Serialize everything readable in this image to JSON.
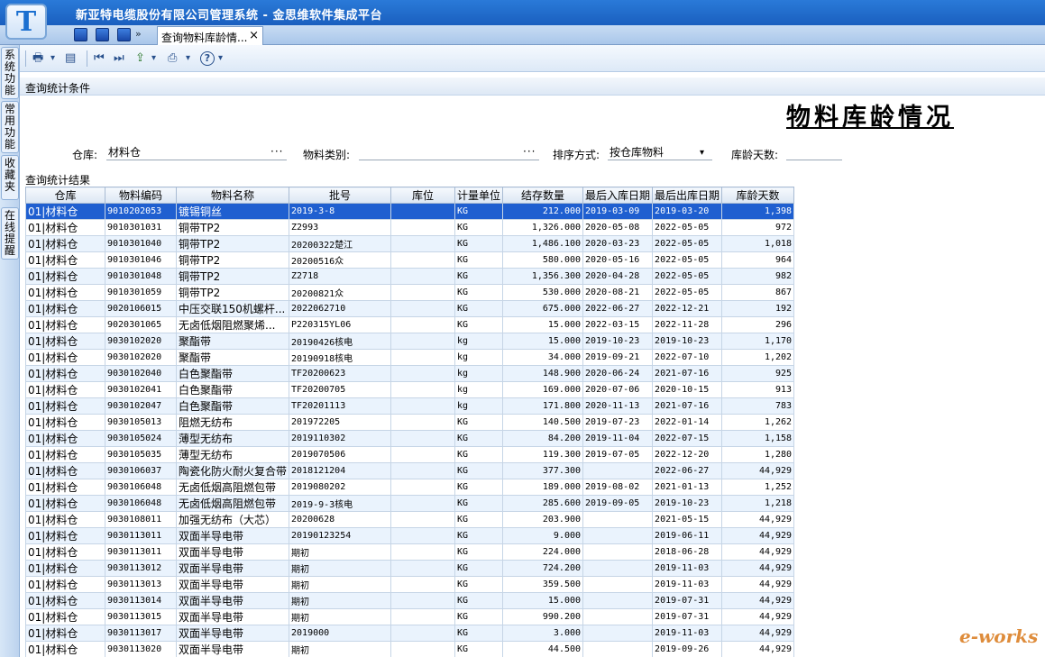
{
  "window": {
    "title": "新亚特电缆股份有限公司管理系统 - 金思维软件集成平台",
    "logo_letter": "T"
  },
  "tabs": {
    "active_label": "查询物料库龄情...",
    "close": "×",
    "quick_more": "»"
  },
  "left_nav": [
    "系统功能",
    "常用功能",
    "收藏夹",
    "在线提醒"
  ],
  "toolbar": {
    "print": "🖶",
    "dropdown": "▾",
    "design": "▤",
    "first": "⏮",
    "last": "⏭",
    "export": "⇪",
    "printer": "⎙",
    "help": "?"
  },
  "sections": {
    "criteria": "查询统计条件",
    "results": "查询统计结果"
  },
  "report_title": "物料库龄情况",
  "filters": {
    "warehouse_label": "仓库:",
    "warehouse_value": "材料仓",
    "warehouse_dots": "···",
    "category_label": "物料类别:",
    "category_value": "",
    "category_dots": "···",
    "sort_label": "排序方式:",
    "sort_value": "按仓库物料",
    "sort_caret": "▾",
    "days_label": "库龄天数:",
    "days_value": ""
  },
  "table": {
    "columns": [
      "仓库",
      "物料编码",
      "物料名称",
      "批号",
      "库位",
      "计量单位",
      "结存数量",
      "最后入库日期",
      "最后出库日期",
      "库龄天数"
    ],
    "rows": [
      [
        "01|材料仓",
        "9010202053",
        "镀锡铜丝",
        "2019-3-8",
        "",
        "KG",
        "212.000",
        "2019-03-09",
        "2019-03-20",
        "1,398"
      ],
      [
        "01|材料仓",
        "9010301031",
        "铜带TP2",
        "Z2993",
        "",
        "KG",
        "1,326.000",
        "2020-05-08",
        "2022-05-05",
        "972"
      ],
      [
        "01|材料仓",
        "9010301040",
        "铜带TP2",
        "20200322楚江",
        "",
        "KG",
        "1,486.100",
        "2020-03-23",
        "2022-05-05",
        "1,018"
      ],
      [
        "01|材料仓",
        "9010301046",
        "铜带TP2",
        "20200516众",
        "",
        "KG",
        "580.000",
        "2020-05-16",
        "2022-05-05",
        "964"
      ],
      [
        "01|材料仓",
        "9010301048",
        "铜带TP2",
        "Z2718",
        "",
        "KG",
        "1,356.300",
        "2020-04-28",
        "2022-05-05",
        "982"
      ],
      [
        "01|材料仓",
        "9010301059",
        "铜带TP2",
        "20200821众",
        "",
        "KG",
        "530.000",
        "2020-08-21",
        "2022-05-05",
        "867"
      ],
      [
        "01|材料仓",
        "9020106015",
        "中压交联150机螺杆...",
        "2022062710",
        "",
        "KG",
        "675.000",
        "2022-06-27",
        "2022-12-21",
        "192"
      ],
      [
        "01|材料仓",
        "9020301065",
        "无卤低烟阻燃聚烯...",
        "P220315YL06",
        "",
        "KG",
        "15.000",
        "2022-03-15",
        "2022-11-28",
        "296"
      ],
      [
        "01|材料仓",
        "9030102020",
        "聚酯带",
        "20190426核电",
        "",
        "kg",
        "15.000",
        "2019-10-23",
        "2019-10-23",
        "1,170"
      ],
      [
        "01|材料仓",
        "9030102020",
        "聚酯带",
        "20190918核电",
        "",
        "kg",
        "34.000",
        "2019-09-21",
        "2022-07-10",
        "1,202"
      ],
      [
        "01|材料仓",
        "9030102040",
        "白色聚酯带",
        "TF20200623",
        "",
        "kg",
        "148.900",
        "2020-06-24",
        "2021-07-16",
        "925"
      ],
      [
        "01|材料仓",
        "9030102041",
        "白色聚酯带",
        "TF20200705",
        "",
        "kg",
        "169.000",
        "2020-07-06",
        "2020-10-15",
        "913"
      ],
      [
        "01|材料仓",
        "9030102047",
        "白色聚酯带",
        "TF20201113",
        "",
        "kg",
        "171.800",
        "2020-11-13",
        "2021-07-16",
        "783"
      ],
      [
        "01|材料仓",
        "9030105013",
        "阻燃无纺布",
        "201972205",
        "",
        "KG",
        "140.500",
        "2019-07-23",
        "2022-01-14",
        "1,262"
      ],
      [
        "01|材料仓",
        "9030105024",
        "薄型无纺布",
        "2019110302",
        "",
        "KG",
        "84.200",
        "2019-11-04",
        "2022-07-15",
        "1,158"
      ],
      [
        "01|材料仓",
        "9030105035",
        "薄型无纺布",
        "2019070506",
        "",
        "KG",
        "119.300",
        "2019-07-05",
        "2022-12-20",
        "1,280"
      ],
      [
        "01|材料仓",
        "9030106037",
        "陶瓷化防火耐火复合带",
        "2018121204",
        "",
        "KG",
        "377.300",
        "",
        "2022-06-27",
        "44,929"
      ],
      [
        "01|材料仓",
        "9030106048",
        "无卤低烟高阻燃包带",
        "2019080202",
        "",
        "KG",
        "189.000",
        "2019-08-02",
        "2021-01-13",
        "1,252"
      ],
      [
        "01|材料仓",
        "9030106048",
        "无卤低烟高阻燃包带",
        "2019-9-3核电",
        "",
        "KG",
        "285.600",
        "2019-09-05",
        "2019-10-23",
        "1,218"
      ],
      [
        "01|材料仓",
        "9030108011",
        "加强无纺布（大芯）",
        "20200628",
        "",
        "KG",
        "203.900",
        "",
        "2021-05-15",
        "44,929"
      ],
      [
        "01|材料仓",
        "9030113011",
        "双面半导电带",
        "20190123254",
        "",
        "KG",
        "9.000",
        "",
        "2019-06-11",
        "44,929"
      ],
      [
        "01|材料仓",
        "9030113011",
        "双面半导电带",
        "期初",
        "",
        "KG",
        "224.000",
        "",
        "2018-06-28",
        "44,929"
      ],
      [
        "01|材料仓",
        "9030113012",
        "双面半导电带",
        "期初",
        "",
        "KG",
        "724.200",
        "",
        "2019-11-03",
        "44,929"
      ],
      [
        "01|材料仓",
        "9030113013",
        "双面半导电带",
        "期初",
        "",
        "KG",
        "359.500",
        "",
        "2019-11-03",
        "44,929"
      ],
      [
        "01|材料仓",
        "9030113014",
        "双面半导电带",
        "期初",
        "",
        "KG",
        "15.000",
        "",
        "2019-07-31",
        "44,929"
      ],
      [
        "01|材料仓",
        "9030113015",
        "双面半导电带",
        "期初",
        "",
        "KG",
        "990.200",
        "",
        "2019-07-31",
        "44,929"
      ],
      [
        "01|材料仓",
        "9030113017",
        "双面半导电带",
        "2019000",
        "",
        "KG",
        "3.000",
        "",
        "2019-11-03",
        "44,929"
      ],
      [
        "01|材料仓",
        "9030113020",
        "双面半导电带",
        "期初",
        "",
        "KG",
        "44.500",
        "",
        "2019-09-26",
        "44,929"
      ]
    ]
  },
  "watermark": "e-works"
}
